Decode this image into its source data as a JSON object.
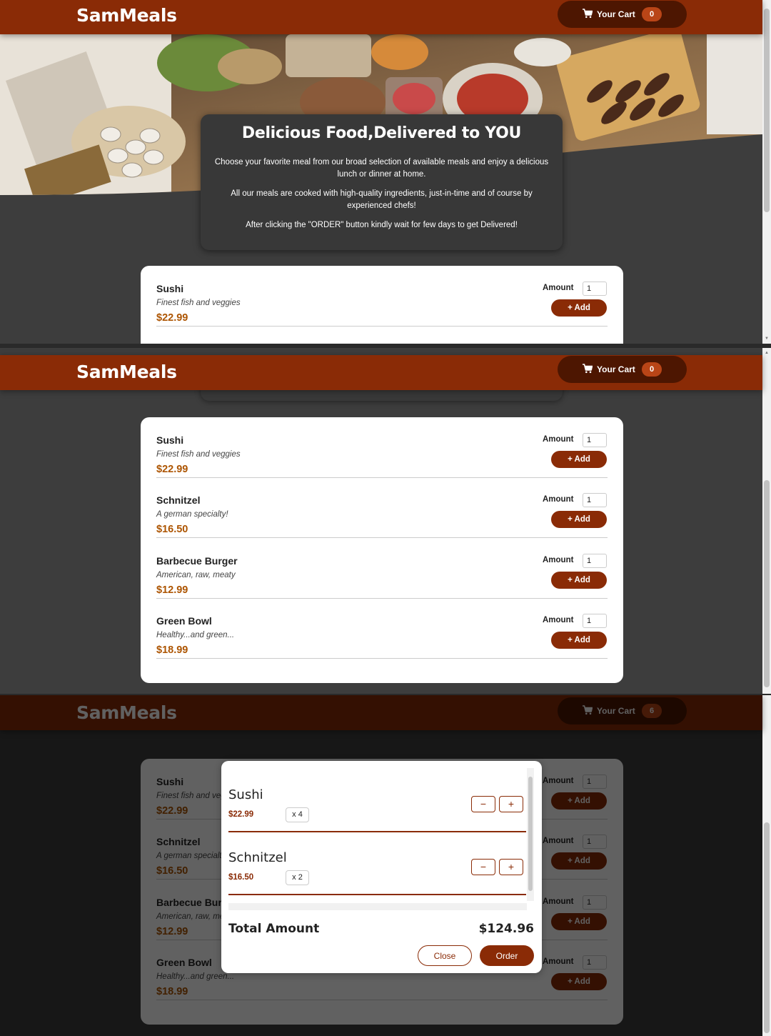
{
  "brand": "SamMeals",
  "cart": {
    "label": "Your Cart",
    "count_empty": "0",
    "count_full": "6"
  },
  "summary": {
    "heading": "Delicious Food,Delivered to YOU",
    "para1": "Choose your favorite meal from our broad selection of available meals and enjoy a delicious lunch or dinner at home.",
    "para2": "All our meals are cooked with high-quality ingredients, just-in-time and of course by experienced chefs!",
    "para3": "After clicking the \"ORDER\" button kindly wait for few days to get Delivered!"
  },
  "meal_form": {
    "amount_label": "Amount",
    "amount_value": "1",
    "add_label": "+ Add"
  },
  "meals": [
    {
      "name": "Sushi",
      "description": "Finest fish and veggies",
      "price": "$22.99"
    },
    {
      "name": "Schnitzel",
      "description": "A german specialty!",
      "price": "$16.50"
    },
    {
      "name": "Barbecue Burger",
      "description": "American, raw, meaty",
      "price": "$12.99"
    },
    {
      "name": "Green Bowl",
      "description": "Healthy...and green...",
      "price": "$18.99"
    }
  ],
  "cart_modal": {
    "items": [
      {
        "name": "Sushi",
        "price": "$22.99",
        "quantity": "x 4"
      },
      {
        "name": "Schnitzel",
        "price": "$16.50",
        "quantity": "x 2"
      }
    ],
    "minus_label": "−",
    "plus_label": "+",
    "total_label": "Total Amount",
    "total_value": "$124.96",
    "close_label": "Close",
    "order_label": "Order"
  },
  "colors": {
    "header": "#8a2b06",
    "cart_button": "#4d1601",
    "badge": "#b94517",
    "price": "#ad5502",
    "background": "#3d3d3d"
  }
}
